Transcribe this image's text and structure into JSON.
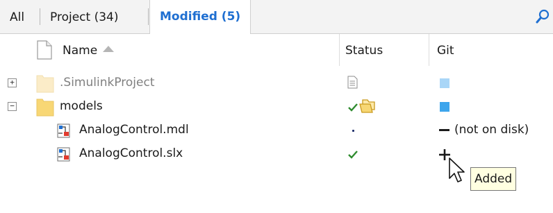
{
  "tabs": {
    "all": "All",
    "project": "Project (34)",
    "modified": "Modified (5)"
  },
  "search": {
    "icon": "magnifier-icon"
  },
  "columns": {
    "name": "Name",
    "status": "Status",
    "git": "Git",
    "name_sort": "ascending"
  },
  "rows": [
    {
      "expander": "+",
      "icon": "folder-icon",
      "name": ".SimulinkProject",
      "status_icon": "document-icon",
      "git_status": "",
      "git_icon": "square-light-blue"
    },
    {
      "expander": "−",
      "icon": "folder-icon",
      "name": "models",
      "status_icon": "check-folder-icon",
      "git_status": "",
      "git_icon": "square-blue"
    },
    {
      "expander": "",
      "icon": "simulink-model-icon",
      "name": "AnalogControl.mdl",
      "status_icon": "dot-icon",
      "git_status": "(not on disk)",
      "git_icon": "minus-icon"
    },
    {
      "expander": "",
      "icon": "simulink-model-icon",
      "name": "AnalogControl.slx",
      "status_icon": "check-icon",
      "git_status": "",
      "git_icon": "plus-icon"
    }
  ],
  "tooltip": "Added",
  "colors": {
    "tab_active": "#1f6fd1",
    "check_green": "#2e8b2e",
    "git_square_blue": "#3da5ec",
    "git_square_light": "#a9d6f7",
    "tooltip_bg": "#ffffe1"
  }
}
